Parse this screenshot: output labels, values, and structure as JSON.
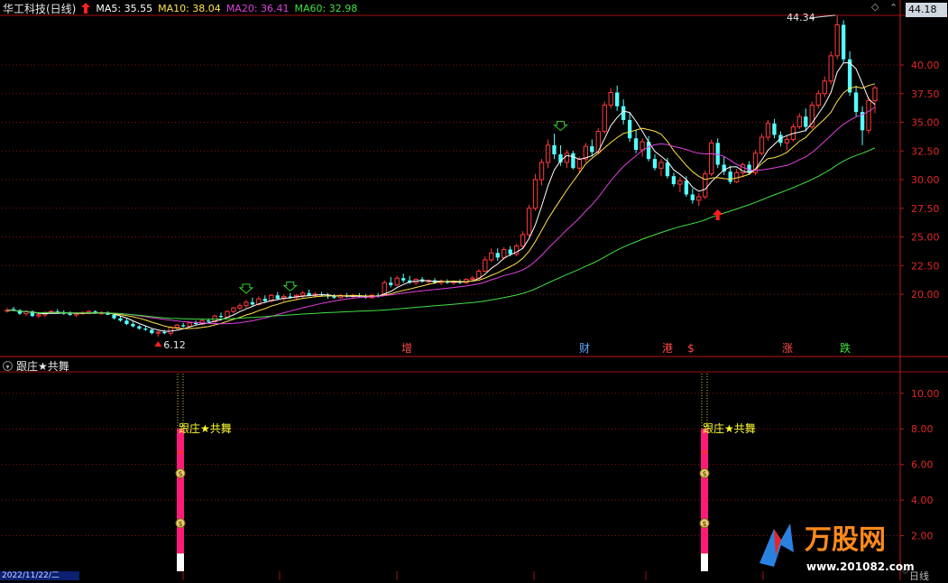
{
  "stock": {
    "name": "华工科技(日线)"
  },
  "ma": [
    {
      "label": "MA5: 35.55",
      "color": "#ffffff"
    },
    {
      "label": "MA10: 38.04",
      "color": "#ffe14a"
    },
    {
      "label": "MA20: 36.41",
      "color": "#e040e0"
    },
    {
      "label": "MA60: 32.98",
      "color": "#40e040"
    }
  ],
  "current_price": "44.18",
  "high_marker": "44.34",
  "low_marker": "6.12",
  "indicator": {
    "name": "跟庄★共舞",
    "signal_text": "跟庄★共舞",
    "y_labels": [
      "10.00",
      "8.00",
      "6.00",
      "4.00",
      "2.00"
    ]
  },
  "price_axis": [
    "40.00",
    "37.50",
    "35.00",
    "32.50",
    "30.00",
    "27.50",
    "25.00",
    "22.50",
    "20.00"
  ],
  "events": [
    {
      "label": "增",
      "color": "#ff4a4a"
    },
    {
      "label": "财",
      "color": "#5aa8ff"
    },
    {
      "label": "港",
      "color": "#ff4a4a"
    },
    {
      "label": "$",
      "color": "#ff4a4a"
    },
    {
      "label": "涨",
      "color": "#ff4a4a"
    },
    {
      "label": "跌",
      "color": "#40e040"
    }
  ],
  "date_box": "2022/11/22/二",
  "period": "日线",
  "logo": {
    "name": "万股网",
    "url": "www.201082.com"
  },
  "colors": {
    "up": "#ff3a3a",
    "down": "#54ffff",
    "grid": "#8a1010"
  },
  "chart_data": {
    "type": "candlestick",
    "title": "华工科技(日线)",
    "ylim": [
      15.5,
      45
    ],
    "candles": [
      [
        18.6,
        18.8,
        18.4,
        18.6
      ],
      [
        18.7,
        18.9,
        18.5,
        18.6
      ],
      [
        18.6,
        18.7,
        18.2,
        18.3
      ],
      [
        18.3,
        18.6,
        18.1,
        18.5
      ],
      [
        18.5,
        18.6,
        18.0,
        18.1
      ],
      [
        18.1,
        18.3,
        17.9,
        18.2
      ],
      [
        18.2,
        18.5,
        18.0,
        18.4
      ],
      [
        18.4,
        18.6,
        18.3,
        18.5
      ],
      [
        18.5,
        18.7,
        18.3,
        18.4
      ],
      [
        18.4,
        18.6,
        18.2,
        18.3
      ],
      [
        18.3,
        18.5,
        18.1,
        18.2
      ],
      [
        18.2,
        18.4,
        18.0,
        18.3
      ],
      [
        18.3,
        18.5,
        18.2,
        18.4
      ],
      [
        18.4,
        18.6,
        18.3,
        18.5
      ],
      [
        18.5,
        18.6,
        18.3,
        18.3
      ],
      [
        18.3,
        18.5,
        18.2,
        18.4
      ],
      [
        18.4,
        18.5,
        18.2,
        18.2
      ],
      [
        18.2,
        18.3,
        17.8,
        17.9
      ],
      [
        17.9,
        18.1,
        17.6,
        17.7
      ],
      [
        17.7,
        17.9,
        17.3,
        17.4
      ],
      [
        17.4,
        17.6,
        17.1,
        17.2
      ],
      [
        17.2,
        17.3,
        16.9,
        17.0
      ],
      [
        17.0,
        17.2,
        16.8,
        16.9
      ],
      [
        16.9,
        17.0,
        16.5,
        16.6
      ],
      [
        16.6,
        16.8,
        16.3,
        16.7
      ],
      [
        16.7,
        16.9,
        16.5,
        16.6
      ],
      [
        16.6,
        17.2,
        16.4,
        17.1
      ],
      [
        17.1,
        17.4,
        16.9,
        17.3
      ],
      [
        17.3,
        17.5,
        17.1,
        17.2
      ],
      [
        17.2,
        17.6,
        17.1,
        17.5
      ],
      [
        17.5,
        17.7,
        17.3,
        17.4
      ],
      [
        17.4,
        17.8,
        17.3,
        17.7
      ],
      [
        17.7,
        17.9,
        17.5,
        17.6
      ],
      [
        17.6,
        18.2,
        17.5,
        18.1
      ],
      [
        18.1,
        18.4,
        17.9,
        18.0
      ],
      [
        18.0,
        18.6,
        17.9,
        18.5
      ],
      [
        18.5,
        18.9,
        18.3,
        18.8
      ],
      [
        18.8,
        19.2,
        18.6,
        19.0
      ],
      [
        19.0,
        19.5,
        18.8,
        19.3
      ],
      [
        19.3,
        19.7,
        19.0,
        19.1
      ],
      [
        19.1,
        19.8,
        19.0,
        19.6
      ],
      [
        19.6,
        19.9,
        19.3,
        19.4
      ],
      [
        19.4,
        20.0,
        19.3,
        19.9
      ],
      [
        19.9,
        20.2,
        19.5,
        19.6
      ],
      [
        19.6,
        20.0,
        19.4,
        19.8
      ],
      [
        19.8,
        20.1,
        19.6,
        19.7
      ],
      [
        19.7,
        20.0,
        19.5,
        19.9
      ],
      [
        19.9,
        20.3,
        19.7,
        20.1
      ],
      [
        20.1,
        20.4,
        19.8,
        19.9
      ],
      [
        19.9,
        20.2,
        19.7,
        20.0
      ],
      [
        20.0,
        20.2,
        19.8,
        19.9
      ],
      [
        19.9,
        20.1,
        19.6,
        19.8
      ],
      [
        19.8,
        20.0,
        19.6,
        19.7
      ],
      [
        19.7,
        20.0,
        19.6,
        19.9
      ],
      [
        19.9,
        20.1,
        19.7,
        19.8
      ],
      [
        19.8,
        20.0,
        19.6,
        19.9
      ],
      [
        19.9,
        20.1,
        19.7,
        19.8
      ],
      [
        19.8,
        20.0,
        19.6,
        19.7
      ],
      [
        19.7,
        20.0,
        19.6,
        19.9
      ],
      [
        19.9,
        20.1,
        19.7,
        19.8
      ],
      [
        20.0,
        21.2,
        19.9,
        21.0
      ],
      [
        21.0,
        21.5,
        20.6,
        20.8
      ],
      [
        20.8,
        21.6,
        20.7,
        21.4
      ],
      [
        21.4,
        21.8,
        21.0,
        21.2
      ],
      [
        21.2,
        21.6,
        20.9,
        21.0
      ],
      [
        21.0,
        21.4,
        20.8,
        21.3
      ],
      [
        21.3,
        21.5,
        21.0,
        21.1
      ],
      [
        21.1,
        21.3,
        20.9,
        21.2
      ],
      [
        21.2,
        21.4,
        20.9,
        21.0
      ],
      [
        21.0,
        21.3,
        20.8,
        21.1
      ],
      [
        21.1,
        21.3,
        20.9,
        21.0
      ],
      [
        21.0,
        21.2,
        20.8,
        21.1
      ],
      [
        21.1,
        21.3,
        20.9,
        21.0
      ],
      [
        21.0,
        21.4,
        20.9,
        21.3
      ],
      [
        21.3,
        21.6,
        21.1,
        21.4
      ],
      [
        21.4,
        22.2,
        21.3,
        22.0
      ],
      [
        22.0,
        23.3,
        21.9,
        23.0
      ],
      [
        23.0,
        24.0,
        22.8,
        23.6
      ],
      [
        23.6,
        24.0,
        22.9,
        23.2
      ],
      [
        23.2,
        24.1,
        23.0,
        23.9
      ],
      [
        23.9,
        24.2,
        23.3,
        23.5
      ],
      [
        23.5,
        24.4,
        23.3,
        24.2
      ],
      [
        24.2,
        25.5,
        24.0,
        25.2
      ],
      [
        25.2,
        27.8,
        25.0,
        27.5
      ],
      [
        27.5,
        30.5,
        27.3,
        30.0
      ],
      [
        30.0,
        31.8,
        29.5,
        31.5
      ],
      [
        31.5,
        33.5,
        31.0,
        33.0
      ],
      [
        33.0,
        34.0,
        31.8,
        32.2
      ],
      [
        32.2,
        33.0,
        31.2,
        31.5
      ],
      [
        31.5,
        32.6,
        31.0,
        32.3
      ],
      [
        32.3,
        32.5,
        30.9,
        31.0
      ],
      [
        31.0,
        32.0,
        30.6,
        31.8
      ],
      [
        31.8,
        33.2,
        31.5,
        32.9
      ],
      [
        32.9,
        33.5,
        32.0,
        32.4
      ],
      [
        32.4,
        34.5,
        32.2,
        34.2
      ],
      [
        34.2,
        36.8,
        34.0,
        36.5
      ],
      [
        36.5,
        38.0,
        36.2,
        37.6
      ],
      [
        37.6,
        38.2,
        36.0,
        36.4
      ],
      [
        36.4,
        37.0,
        34.8,
        35.2
      ],
      [
        35.2,
        35.8,
        33.3,
        33.6
      ],
      [
        33.6,
        34.3,
        32.3,
        32.6
      ],
      [
        32.6,
        33.6,
        32.0,
        33.3
      ],
      [
        33.3,
        33.8,
        31.6,
        31.8
      ],
      [
        31.8,
        32.2,
        30.8,
        31.0
      ],
      [
        31.0,
        31.8,
        30.3,
        31.5
      ],
      [
        31.5,
        31.9,
        30.1,
        30.3
      ],
      [
        30.3,
        30.6,
        29.4,
        29.6
      ],
      [
        29.6,
        30.2,
        28.9,
        29.9
      ],
      [
        29.9,
        30.3,
        28.5,
        28.7
      ],
      [
        28.7,
        29.2,
        27.9,
        28.2
      ],
      [
        28.2,
        28.8,
        27.7,
        28.5
      ],
      [
        28.5,
        30.8,
        28.3,
        30.5
      ],
      [
        30.5,
        33.5,
        30.3,
        33.2
      ],
      [
        33.2,
        33.6,
        31.0,
        31.3
      ],
      [
        31.3,
        32.0,
        30.4,
        30.7
      ],
      [
        30.7,
        31.2,
        29.6,
        29.8
      ],
      [
        29.8,
        30.9,
        29.7,
        30.6
      ],
      [
        30.6,
        31.5,
        30.2,
        31.3
      ],
      [
        31.3,
        31.6,
        30.4,
        30.6
      ],
      [
        30.6,
        32.6,
        30.4,
        32.3
      ],
      [
        32.3,
        34.0,
        32.1,
        33.7
      ],
      [
        33.7,
        35.2,
        33.4,
        34.9
      ],
      [
        34.9,
        35.3,
        33.6,
        33.9
      ],
      [
        33.9,
        34.2,
        32.9,
        33.2
      ],
      [
        33.2,
        33.8,
        32.6,
        33.5
      ],
      [
        33.5,
        34.9,
        33.3,
        34.6
      ],
      [
        34.6,
        35.8,
        34.4,
        35.5
      ],
      [
        35.5,
        36.2,
        34.2,
        34.6
      ],
      [
        34.6,
        36.8,
        34.4,
        36.5
      ],
      [
        36.5,
        37.8,
        36.2,
        37.5
      ],
      [
        37.5,
        39.0,
        37.2,
        38.6
      ],
      [
        38.6,
        41.2,
        38.3,
        40.8
      ],
      [
        40.8,
        44.34,
        40.5,
        43.5
      ],
      [
        43.5,
        43.9,
        40.2,
        40.5
      ],
      [
        40.5,
        41.2,
        37.3,
        37.6
      ],
      [
        37.6,
        38.2,
        35.5,
        35.9
      ],
      [
        35.9,
        36.4,
        33.0,
        34.3
      ],
      [
        34.3,
        37.2,
        34.0,
        36.9
      ],
      [
        36.9,
        38.2,
        35.8,
        38.0
      ]
    ],
    "price_axis": [
      40.0,
      37.5,
      35.0,
      32.5,
      30.0,
      27.5,
      25.0,
      22.5,
      20.0
    ],
    "indicator_axis": [
      10.0,
      8.0,
      6.0,
      4.0,
      2.0
    ]
  }
}
